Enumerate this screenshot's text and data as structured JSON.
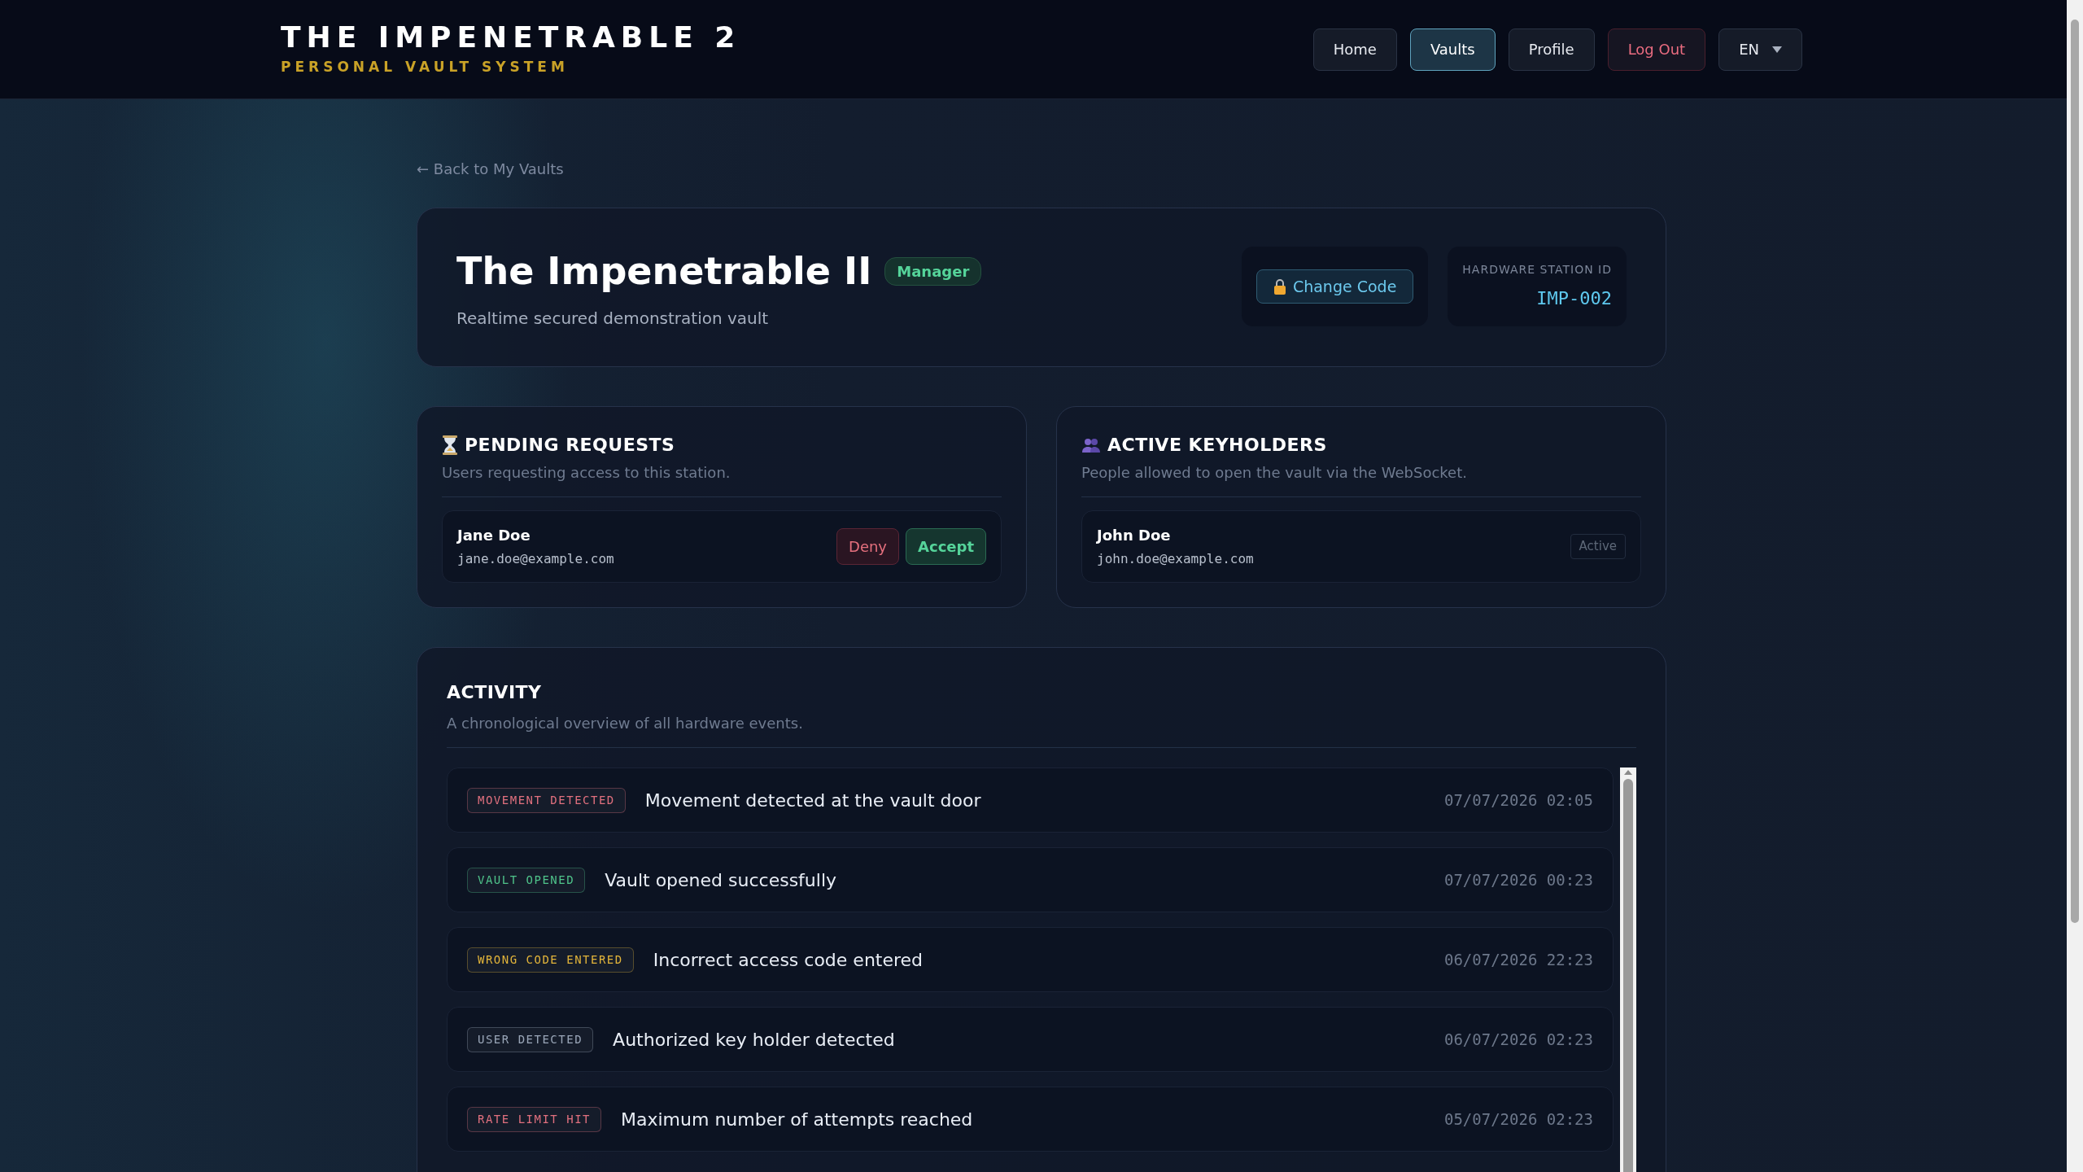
{
  "header": {
    "title": "THE IMPENETRABLE 2",
    "subtitle": "PERSONAL VAULT SYSTEM"
  },
  "nav": [
    {
      "label": "Home",
      "selected": false,
      "kind": "normal"
    },
    {
      "label": "Vaults",
      "selected": true,
      "kind": "normal"
    },
    {
      "label": "Profile",
      "selected": false,
      "kind": "normal"
    },
    {
      "label": "Log Out",
      "selected": false,
      "kind": "danger"
    }
  ],
  "language": {
    "value": "EN"
  },
  "back_link": "← Back to My Vaults",
  "vault": {
    "name": "The Impenetrable II",
    "role": "Manager",
    "description": "Realtime secured demonstration vault",
    "change_code": "Change Code",
    "station_label": "HARDWARE STATION ID",
    "station_id": "IMP-002"
  },
  "pending": {
    "title": "PENDING REQUESTS",
    "subtitle": "Users requesting access to this station.",
    "requests": [
      {
        "name": "Jane Doe",
        "email": "jane.doe@example.com",
        "deny": "Deny",
        "accept": "Accept"
      }
    ]
  },
  "keyholders": {
    "title": "ACTIVE KEYHOLDERS",
    "subtitle": "People allowed to open the vault via the WebSocket.",
    "items": [
      {
        "name": "John Doe",
        "email": "john.doe@example.com",
        "status": "Active"
      }
    ]
  },
  "activity": {
    "title": "ACTIVITY",
    "subtitle": "A chronological overview of all hardware events.",
    "events": [
      {
        "tag": "MOVEMENT DETECTED",
        "color": "#e0707e",
        "message": "Movement detected at the vault door",
        "time": "07/07/2026 02:05"
      },
      {
        "tag": "VAULT OPENED",
        "color": "#4fc38a",
        "message": "Vault opened successfully",
        "time": "07/07/2026 00:23"
      },
      {
        "tag": "WRONG CODE ENTERED",
        "color": "#e2b43a",
        "message": "Incorrect access code entered",
        "time": "06/07/2026 22:23"
      },
      {
        "tag": "USER DETECTED",
        "color": "#9aa6b8",
        "message": "Authorized key holder detected",
        "time": "06/07/2026 02:23"
      },
      {
        "tag": "RATE LIMIT HIT",
        "color": "#e0707e",
        "message": "Maximum number of attempts reached",
        "time": "05/07/2026 02:23"
      }
    ]
  }
}
